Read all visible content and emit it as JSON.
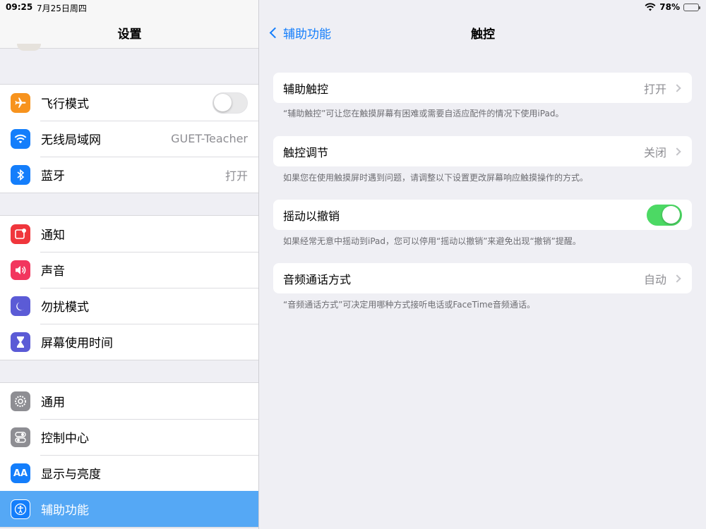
{
  "status": {
    "time": "09:25",
    "date": "7月25日周四",
    "battery": "78%",
    "battery_level": 0.78
  },
  "sidebar": {
    "title": "设置",
    "groups": [
      {
        "items": [
          {
            "label": "飞行模式",
            "icon": "airplane-icon",
            "color": "#f7931e",
            "toggle": false
          },
          {
            "label": "无线局域网",
            "icon": "wifi-icon",
            "color": "#147efb",
            "value": "GUET-Teacher"
          },
          {
            "label": "蓝牙",
            "icon": "bluetooth-icon",
            "color": "#147efb",
            "value": "打开"
          }
        ]
      },
      {
        "items": [
          {
            "label": "通知",
            "icon": "notification-icon",
            "color": "#f0363c"
          },
          {
            "label": "声音",
            "icon": "sound-icon",
            "color": "#f2365e"
          },
          {
            "label": "勿扰模式",
            "icon": "moon-icon",
            "color": "#5b5bd6"
          },
          {
            "label": "屏幕使用时间",
            "icon": "hourglass-icon",
            "color": "#5b5bd6"
          }
        ]
      },
      {
        "items": [
          {
            "label": "通用",
            "icon": "gear-icon",
            "color": "#8e8e93"
          },
          {
            "label": "控制中心",
            "icon": "switches-icon",
            "color": "#8e8e93"
          },
          {
            "label": "显示与亮度",
            "icon": "display-icon",
            "color": "#147efb",
            "glyph": "AA"
          },
          {
            "label": "辅助功能",
            "icon": "accessibility-icon",
            "color": "#147efb",
            "selected": true
          }
        ]
      }
    ]
  },
  "main": {
    "back_label": "辅助功能",
    "title": "触控",
    "sections": [
      {
        "label": "辅助触控",
        "value": "打开",
        "footer": "“辅助触控”可让您在触摸屏幕有困难或需要自适应配件的情况下使用iPad。"
      },
      {
        "label": "触控调节",
        "value": "关闭",
        "footer": "如果您在使用触摸屏时遇到问题，请调整以下设置更改屏幕响应触摸操作的方式。"
      },
      {
        "label": "摇动以撤销",
        "toggle": true,
        "footer": "如果经常无意中摇动到iPad，您可以停用“摇动以撤销”来避免出现“撤销”提醒。"
      },
      {
        "label": "音频通话方式",
        "value": "自动",
        "footer": "“音频通话方式”可决定用哪种方式接听电话或FaceTime音频通话。"
      }
    ]
  }
}
